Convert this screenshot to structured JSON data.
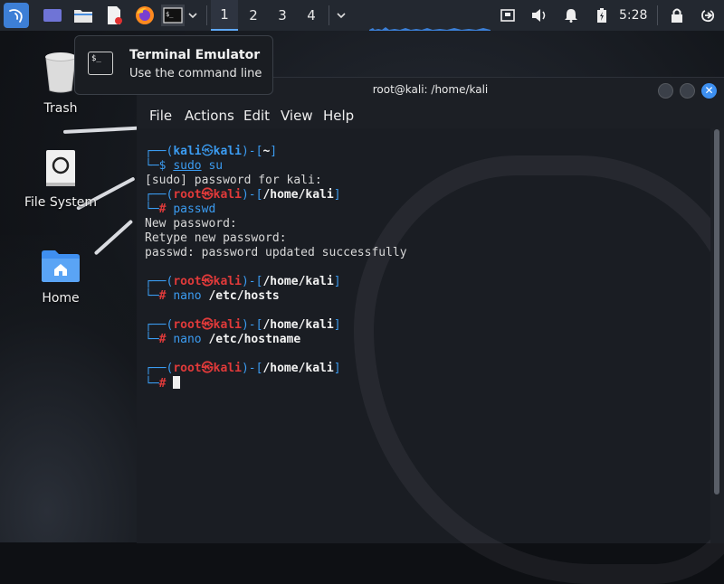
{
  "panel": {
    "workspaces": [
      "1",
      "2",
      "3",
      "4"
    ],
    "active_workspace": "1",
    "clock": "5:28"
  },
  "tooltip": {
    "title": "Terminal Emulator",
    "subtitle": "Use the command line",
    "icon_text": "$_"
  },
  "desktop": {
    "icons": [
      {
        "label": "Trash",
        "icon": "trash-icon"
      },
      {
        "label": "File System",
        "icon": "drive-icon"
      },
      {
        "label": "Home",
        "icon": "home-folder-icon"
      }
    ]
  },
  "terminal": {
    "title": "root@kali: /home/kali",
    "menu": [
      "File",
      "Actions",
      "Edit",
      "View",
      "Help"
    ],
    "prompt_user": {
      "user": "kali",
      "host": "kali",
      "dir": "~",
      "symbol": "$"
    },
    "prompt_root": {
      "user": "root",
      "host": "kali",
      "dir": "/home/kali",
      "symbol": "#"
    },
    "commands": {
      "sudo": "sudo",
      "su": " su",
      "passwd": "passwd",
      "nano": "nano",
      "hosts_arg": "/etc/hosts",
      "hostname_arg": "/etc/hostname"
    },
    "output": {
      "sudo_pw": "[sudo] password for kali:",
      "new_pw": "New password:",
      "retype_pw": "Retype new password:",
      "pw_ok": "passwd: password updated successfully"
    }
  },
  "colors": {
    "accent": "#3b9bf0",
    "root_red": "#e03a3a",
    "panel_bg": "#232830",
    "terminal_bg": "#1a1d23"
  }
}
